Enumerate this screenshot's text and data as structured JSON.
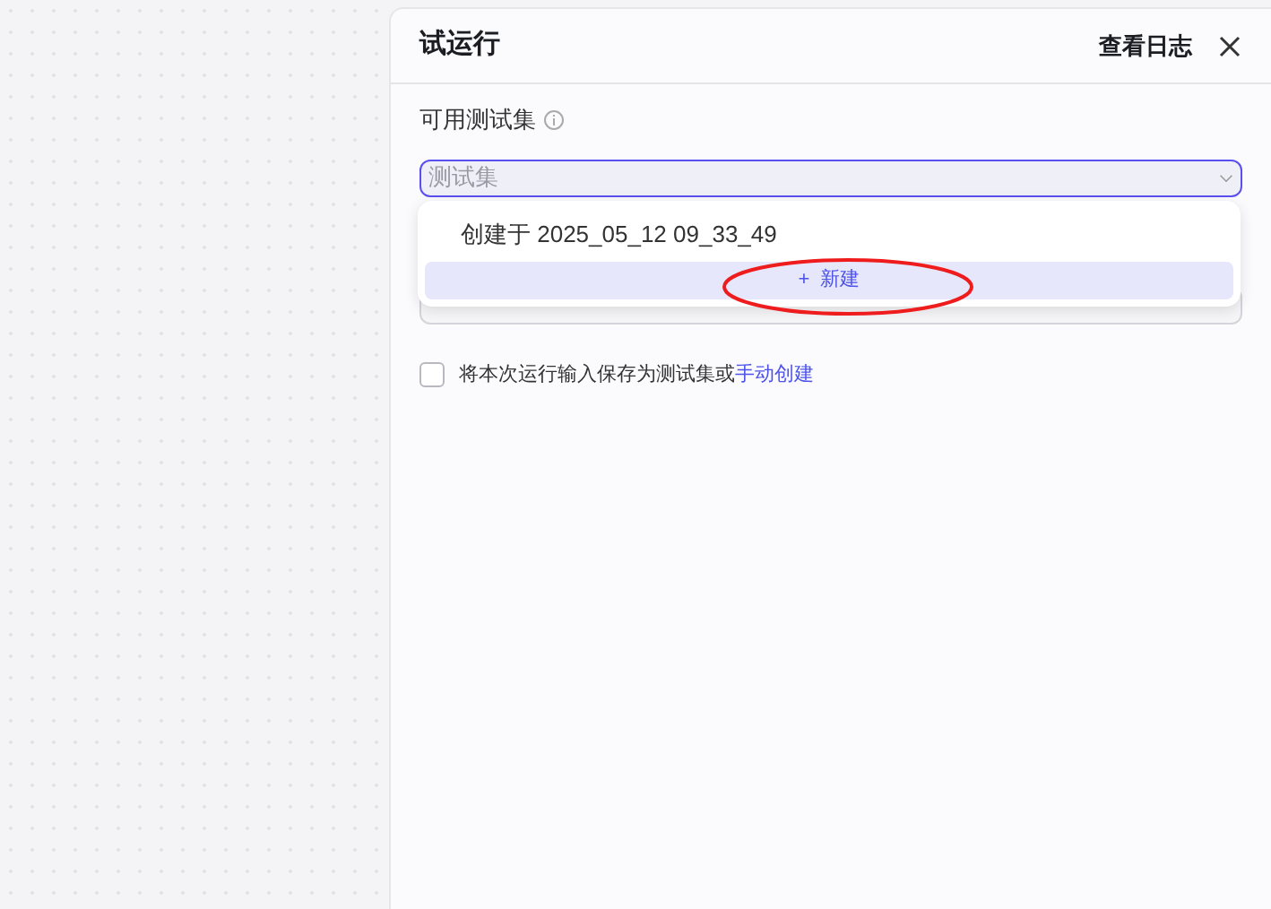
{
  "panel": {
    "title": "试运行",
    "log_link": "查看日志"
  },
  "test_set": {
    "label": "可用测试集",
    "placeholder": "测试集",
    "expanded": true,
    "options": [
      {
        "label": "创建于 2025_05_12 09_33_49",
        "selected": false
      }
    ],
    "new_button": {
      "icon": "+",
      "label": "新建"
    }
  },
  "save_option": {
    "checked": false,
    "text": "将本次运行输入保存为测试集或",
    "link": "手动创建"
  },
  "annotation": {
    "kind": "ellipse",
    "color": "#ee1c1c"
  }
}
